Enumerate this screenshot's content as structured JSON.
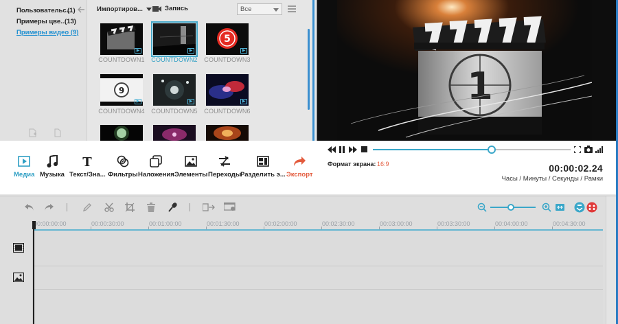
{
  "library": {
    "items": [
      {
        "label": "Пользовательс...",
        "count": "(1)"
      },
      {
        "label": "Примеры цве...",
        "count": "(13)"
      },
      {
        "label": "Примеры видео (9)",
        "count": ""
      }
    ]
  },
  "media": {
    "import_label": "Импортиров...",
    "record_label": "Запись",
    "filter_value": "Все",
    "thumbnails": [
      {
        "label": "COUNTDOWN1",
        "selected": false
      },
      {
        "label": "COUNTDOWN2",
        "selected": true
      },
      {
        "label": "COUNTDOWN3",
        "selected": false
      },
      {
        "label": "COUNTDOWN4",
        "selected": false
      },
      {
        "label": "COUNTDOWN5",
        "selected": false
      },
      {
        "label": "COUNTDOWN6",
        "selected": false
      }
    ]
  },
  "categories": [
    {
      "label": "Медиа",
      "icon": "media-icon",
      "active": true
    },
    {
      "label": "Музыка",
      "icon": "music-icon"
    },
    {
      "label": "Текст/Зна...",
      "icon": "text-icon"
    },
    {
      "label": "Фильтры",
      "icon": "filters-icon"
    },
    {
      "label": "Наложения",
      "icon": "overlays-icon"
    },
    {
      "label": "Элементы",
      "icon": "elements-icon"
    },
    {
      "label": "Переходы",
      "icon": "transitions-icon"
    },
    {
      "label": "Разделить э...",
      "icon": "split-screen-icon"
    },
    {
      "label": "Экспорт",
      "icon": "export-icon"
    }
  ],
  "player": {
    "progress": 0.6,
    "ratio_label": "Формат экрана:",
    "ratio_value": "16:9",
    "timecode": "00:00:02.24",
    "timecode_units": "Часы / Минуты / Секунды / Рамки"
  },
  "timeline": {
    "ticks": [
      "00:00:00:00",
      "00:00:30:00",
      "00:01:00:00",
      "00:01:30:00",
      "00:02:00:00",
      "00:02:30:00",
      "00:03:00:00",
      "00:03:30:00",
      "00:04:00:00",
      "00:04:30:00"
    ]
  },
  "colors": {
    "accent": "#3aa7c9",
    "export": "#e35b3d",
    "link": "#1f8fd0"
  }
}
